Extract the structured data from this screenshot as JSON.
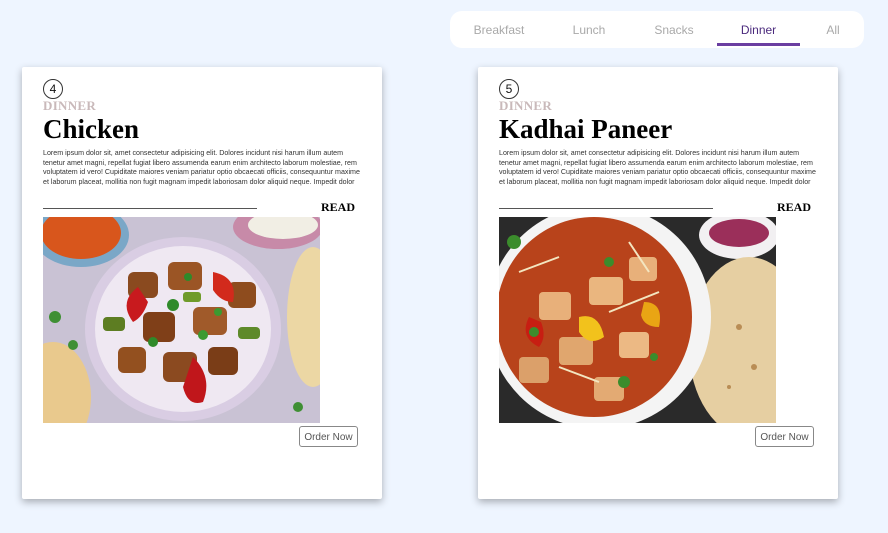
{
  "tabs": [
    {
      "label": "Breakfast"
    },
    {
      "label": "Lunch"
    },
    {
      "label": "Snacks"
    },
    {
      "label": "Dinner"
    },
    {
      "label": "All"
    }
  ],
  "active_tab": "Dinner",
  "cards": [
    {
      "number": "4",
      "category": "DINNER",
      "title": "Chicken",
      "description": "Lorem ipsum dolor sit, amet consectetur adipisicing elit. Dolores incidunt nisi harum illum autem tenetur amet magni, repellat fugiat libero assumenda earum enim architecto laborum molestiae, rem voluptatem id vero! Cupiditate maiores veniam pariatur optio obcaecati officiis, consequuntur maxime et laborum placeat, mollitia non fugit magnam impedit laboriosam dolor aliquid neque. Impedit dolor",
      "read_label": "READ",
      "order_label": "Order Now",
      "image": "chicken-dish-photo"
    },
    {
      "number": "5",
      "category": "DINNER",
      "title": "Kadhai Paneer",
      "description": "Lorem ipsum dolor sit, amet consectetur adipisicing elit. Dolores incidunt nisi harum illum autem tenetur amet magni, repellat fugiat libero assumenda earum enim architecto laborum molestiae, rem voluptatem id vero! Cupiditate maiores veniam pariatur optio obcaecati officiis, consequuntur maxime et laborum placeat, mollitia non fugit magnam impedit laboriosam dolor aliquid neque. Impedit dolor",
      "read_label": "READ",
      "order_label": "Order Now",
      "image": "kadhai-paneer-dish-photo"
    }
  ],
  "colors": {
    "background": "#eef5ff",
    "tab_active_underline": "#6a3ea1",
    "category_text": "#c9b9ba"
  }
}
